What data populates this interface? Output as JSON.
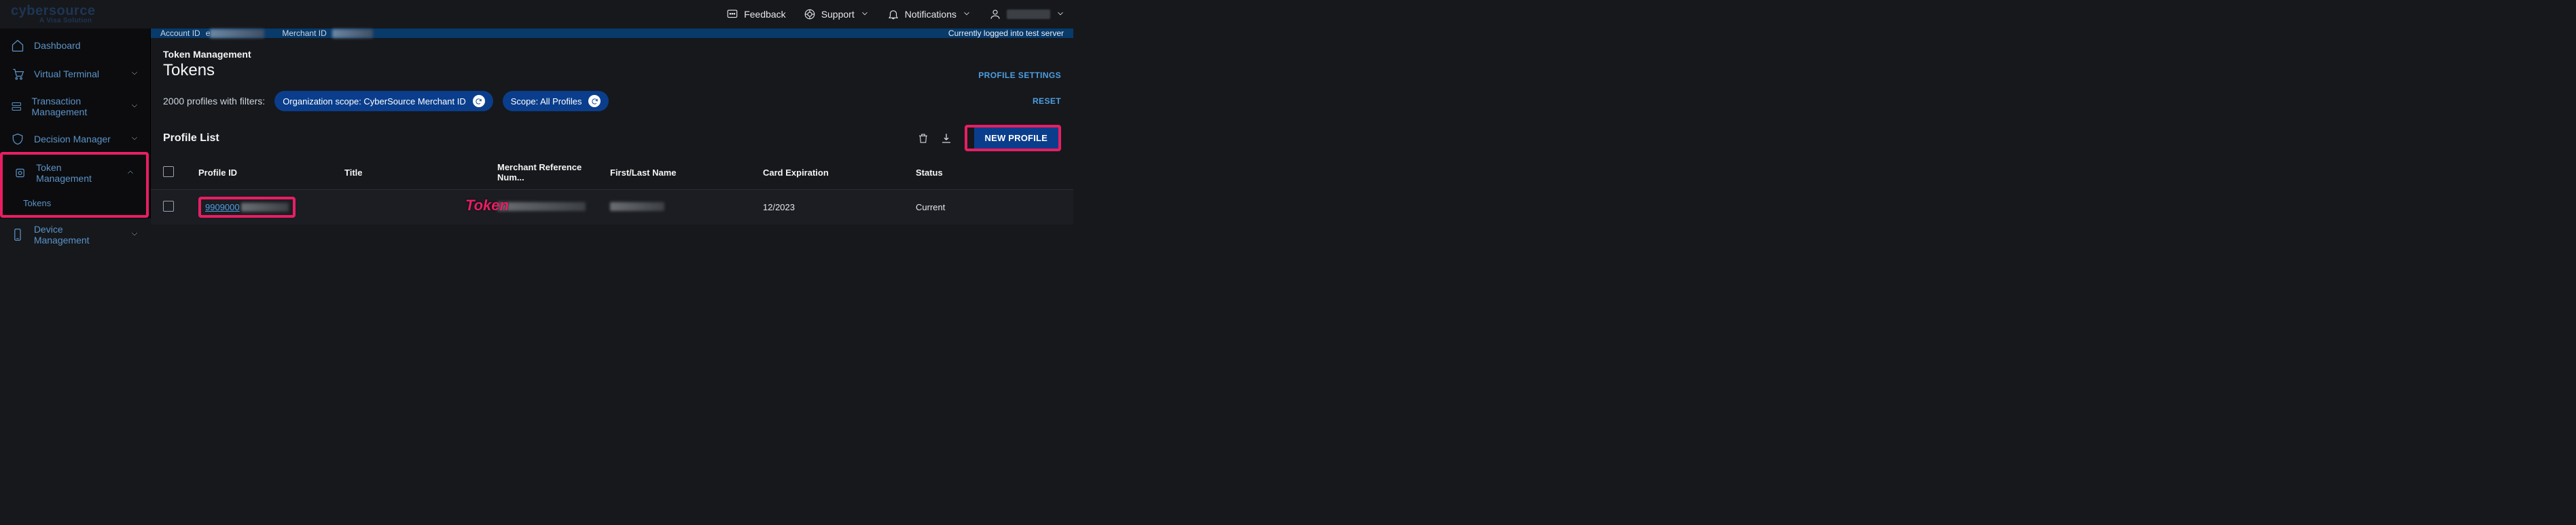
{
  "header": {
    "logo_brand": "cybersource",
    "logo_tag": "A Visa Solution",
    "feedback": "Feedback",
    "support": "Support",
    "notifications": "Notifications"
  },
  "sidebar": {
    "items": [
      {
        "id": "dashboard",
        "label": "Dashboard",
        "expandable": false
      },
      {
        "id": "vterm",
        "label": "Virtual Terminal",
        "expandable": true,
        "expanded": false
      },
      {
        "id": "txnmgmt",
        "label": "Transaction Management",
        "expandable": true,
        "expanded": false
      },
      {
        "id": "decmgr",
        "label": "Decision Manager",
        "expandable": true,
        "expanded": false
      },
      {
        "id": "tokenmgmt",
        "label": "Token Management",
        "expandable": true,
        "expanded": true,
        "children": [
          {
            "id": "tokens",
            "label": "Tokens"
          }
        ]
      },
      {
        "id": "devicemgmt",
        "label": "Device Management",
        "expandable": true,
        "expanded": false
      }
    ]
  },
  "banner": {
    "account_label": "Account ID",
    "account_mask": "e",
    "merchant_label": "Merchant ID",
    "right_text": "Currently logged into test server"
  },
  "page": {
    "kicker": "Token Management",
    "title": "Tokens",
    "profile_settings": "PROFILE SETTINGS"
  },
  "filters": {
    "count_text": "2000 profiles with filters:",
    "pill1": "Organization scope: CyberSource Merchant ID",
    "pill2": "Scope: All Profiles",
    "reset": "RESET"
  },
  "list": {
    "title": "Profile List",
    "new_profile": "NEW PROFILE",
    "columns": {
      "profile_id": "Profile ID",
      "title": "Title",
      "mref": "Merchant Reference Num...",
      "name": "First/Last Name",
      "exp": "Card Expiration",
      "status": "Status"
    },
    "rows": [
      {
        "profile_id": "9909000",
        "title": "",
        "mref": "",
        "name": "",
        "exp": "12/2023",
        "status": "Current"
      }
    ]
  },
  "callouts": {
    "token": "Token"
  }
}
